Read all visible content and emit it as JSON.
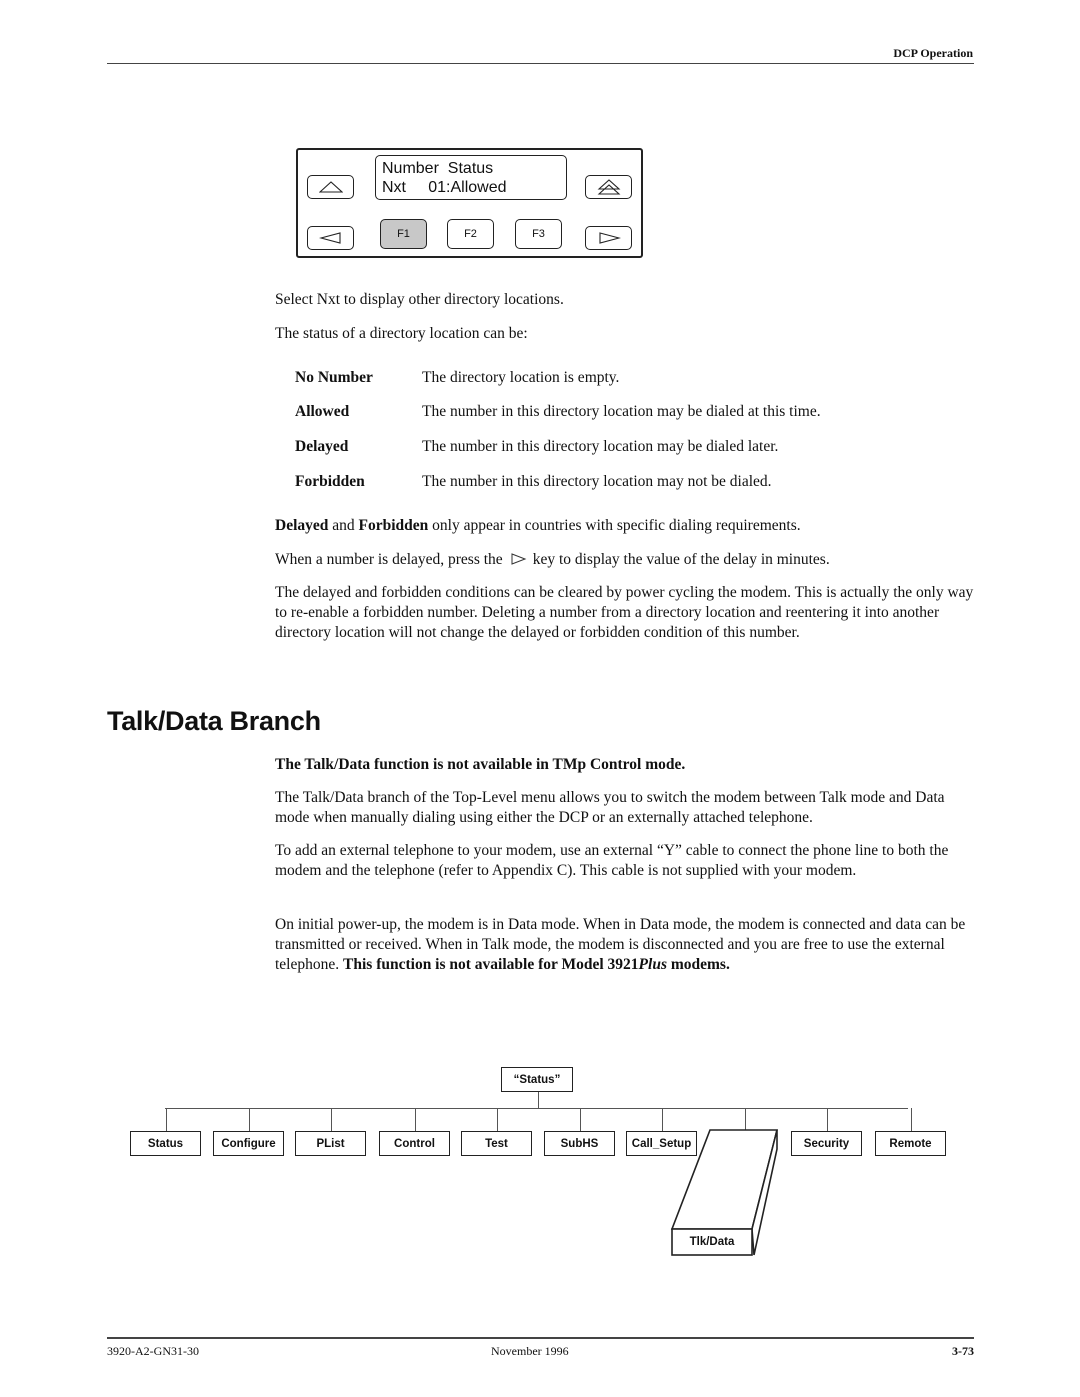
{
  "header": {
    "section_title": "DCP Operation"
  },
  "dcp_panel": {
    "lcd_line1": "Number  Status",
    "lcd_line2": "Nxt     01:Allowed",
    "function_keys": [
      {
        "label": "F1",
        "active": true
      },
      {
        "label": "F2",
        "active": false
      },
      {
        "label": "F3",
        "active": false
      }
    ],
    "icons": [
      "up-arrow-icon",
      "top-level-icon",
      "left-arrow-icon",
      "right-arrow-icon"
    ]
  },
  "intro": {
    "line1": "Select Nxt to display other directory locations.",
    "line2": "The status of a directory location can be:"
  },
  "status_terms": [
    {
      "term": "No Number",
      "description": "The directory location is empty."
    },
    {
      "term": "Allowed",
      "description": "The number in this directory location may be dialed at this time."
    },
    {
      "term": "Delayed",
      "description": "The number in this directory location may be dialed later."
    },
    {
      "term": "Forbidden",
      "description": "The number in this directory location may not be dialed."
    }
  ],
  "note_delayed_forbidden": {
    "bold1": "Delayed",
    "mid": " and ",
    "bold2": "Forbidden",
    "rest": " only appear in countries with specific dialing requirements."
  },
  "note_delay_key": {
    "before": "When a number is delayed, press the",
    "after": "key to display the value of the delay in minutes."
  },
  "para_clear": "The delayed and forbidden conditions can be cleared by power cycling the modem. This is actually the only way to re-enable a forbidden number. Deleting a number from a directory location and reentering it into another directory location will not change the delayed or forbidden condition of this number.",
  "section": {
    "title": "Talk/Data Branch",
    "warning": "The Talk/Data function is not available in TMp Control mode.",
    "para1": "The Talk/Data branch of the Top-Level menu allows you to switch the modem between Talk mode and Data mode when manually dialing using either the DCP or an externally attached telephone.",
    "para2": "To add an external telephone to your modem, use an external “Y” cable to connect the phone line to both the modem and the telephone (refer to Appendix C). This cable is not supplied with your modem.",
    "para3_plain": "On initial power-up, the modem is in Data mode. When in Data mode, the modem is connected and data can be transmitted or received. When in Talk mode, the modem is disconnected and you are free to use the external telephone. ",
    "para3_bold": "This function is not available for Model 3921",
    "para3_bold_italic": "Plus",
    "para3_bold_end": " modems."
  },
  "menu_tree": {
    "root": "“Status”",
    "children": [
      "Status",
      "Configure",
      "PList",
      "Control",
      "Test",
      "SubHS",
      "Call_Setup",
      "",
      "Security",
      "Remote"
    ],
    "highlighted": "Tlk/Data"
  },
  "footer": {
    "doc_number": "3920-A2-GN31-30",
    "date": "November 1996",
    "page": "3-73"
  }
}
